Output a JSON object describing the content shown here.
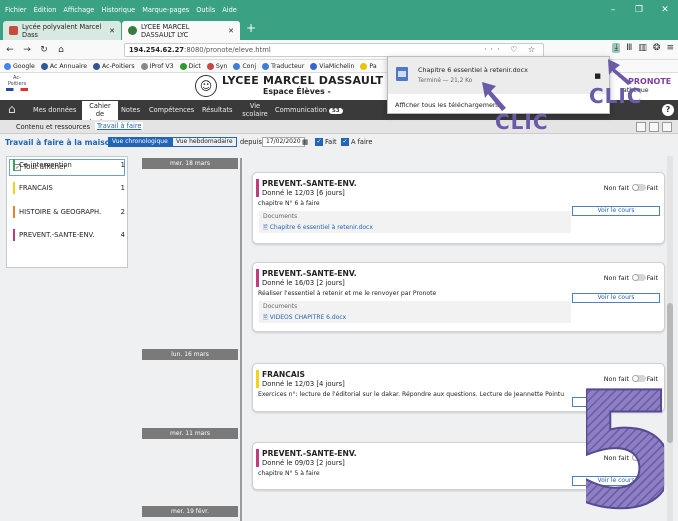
{
  "browser": {
    "menu": [
      "Fichier",
      "Édition",
      "Affichage",
      "Historique",
      "Marque-pages",
      "Outils",
      "Aide"
    ],
    "window_controls": [
      "–",
      "❐",
      "✕"
    ],
    "tabs": [
      {
        "label": "Lycée polyvalent Marcel Dass",
        "close": "✕"
      },
      {
        "label": "LYCEE MARCEL DASSAULT LYC",
        "close": "✕"
      }
    ],
    "new_tab": "+",
    "url_host": "194.254.62.27",
    "url_rest": ":8080/pronote/eleve.html",
    "url_icons": "··· ♡ ☆",
    "nav_icons": {
      "back": "←",
      "forward": "→",
      "reload": "↻",
      "home": "⌂"
    },
    "toolbar_icons": {
      "download": "⤓",
      "library": "Ⅲ",
      "sidebar": "▥",
      "extension": "❂",
      "menu": "≡"
    },
    "bookmarks": [
      {
        "label": "Google",
        "color": "#4285f4"
      },
      {
        "label": "Ac Annuaire",
        "color": "#335599"
      },
      {
        "label": "Ac-Poitiers",
        "color": "#335599"
      },
      {
        "label": "IProf V3",
        "color": "#888888"
      },
      {
        "label": "Dict",
        "color": "#2b9b2b"
      },
      {
        "label": "Syn",
        "color": "#cc4444"
      },
      {
        "label": "Conj",
        "color": "#3b7dd8"
      },
      {
        "label": "Traducteur",
        "color": "#3b7dd8"
      },
      {
        "label": "ViaMichelin",
        "color": "#3366cc"
      },
      {
        "label": "Pa",
        "color": "#e8c400"
      }
    ]
  },
  "downloads": {
    "file_name": "Chapitre 6 essentiel à retenir.docx",
    "status": "Terminé — 21,2 Ko",
    "show_all": "Afficher tous les téléchargements",
    "extra": "athèque"
  },
  "site": {
    "school": "LYCEE MARCEL DASSAULT LY",
    "space": "Espace Élèves -",
    "logo_text": "Ac-Poitiers",
    "pronote_logo": "PRONOTE"
  },
  "nav": {
    "home_icon": "⌂",
    "items": [
      "Mes données",
      "Cahier de textes",
      "Notes",
      "Compétences",
      "Résultats",
      "Vie scolaire",
      "Communication"
    ],
    "communication_badge": "53",
    "help": "?"
  },
  "subnav": {
    "items": [
      "Contenu et ressources",
      "Travail à faire"
    ]
  },
  "filter": {
    "title": "Travail à faire à la maison",
    "view_chrono": "Vue chronologique",
    "view_weekly": "Vue hebdomadaire",
    "since_label": "depuis",
    "since_date": "17/02/2020",
    "fait": "Fait",
    "a_faire": "A faire",
    "calendar_icon": "▦"
  },
  "left_panel": {
    "tout_afficher": "Tout afficher",
    "subjects": [
      {
        "name": "Co-intervention",
        "count": "1",
        "color": "#3aa55d"
      },
      {
        "name": "FRANCAIS",
        "count": "1",
        "color": "#f2d21b"
      },
      {
        "name": "HISTOIRE & GEOGRAPH.",
        "count": "2",
        "color": "#e8832a"
      },
      {
        "name": "PREVENT.-SANTE-ENV.",
        "count": "4",
        "color": "#c43a7a"
      }
    ]
  },
  "dates": [
    "mer. 18 mars",
    "lun. 16 mars",
    "mer. 11 mars",
    "mer. 19 févr."
  ],
  "cards": [
    {
      "subject": "PREVENT.-SANTE-ENV.",
      "given": "Donné le 12/03 [6 jours]",
      "desc": "chapitre N° 6 à faire",
      "docs_label": "Documents",
      "doc": "Chapitre 6 essentiel à retenir.docx",
      "non_fait": "Non fait",
      "fait": "Fait",
      "voir": "Voir le cours",
      "color": "#c43a7a"
    },
    {
      "subject": "PREVENT.-SANTE-ENV.",
      "given": "Donné le 16/03 [2 jours]",
      "desc": "Réaliser l'essentiel à retenir et me le renvoyer par Pronote",
      "docs_label": "Documents",
      "doc": "VIDEOS CHAPITRE 6.docx",
      "non_fait": "Non fait",
      "fait": "Fait",
      "voir": "Voir le cours",
      "color": "#c43a7a"
    },
    {
      "subject": "FRANCAIS",
      "given": "Donné le 12/03 [4 jours]",
      "desc": "Exercices n°: lecture de l'éditorial sur le dakar. Répondre aux questions. Lecture de Jeannette Pointu",
      "non_fait": "Non fait",
      "fait": "Fait",
      "voir": "Voir le cours",
      "color": "#f2d21b"
    },
    {
      "subject": "PREVENT.-SANTE-ENV.",
      "given": "Donné le 09/03 [2 jours]",
      "desc": "chapitre N° 5 à faire",
      "non_fait": "Non fait",
      "fait": "Fait",
      "voir": "Voir le cours",
      "color": "#c43a7a"
    }
  ],
  "annotations": {
    "clic": "CLIC",
    "step_number": "5",
    "color": "#6a5aa8"
  }
}
